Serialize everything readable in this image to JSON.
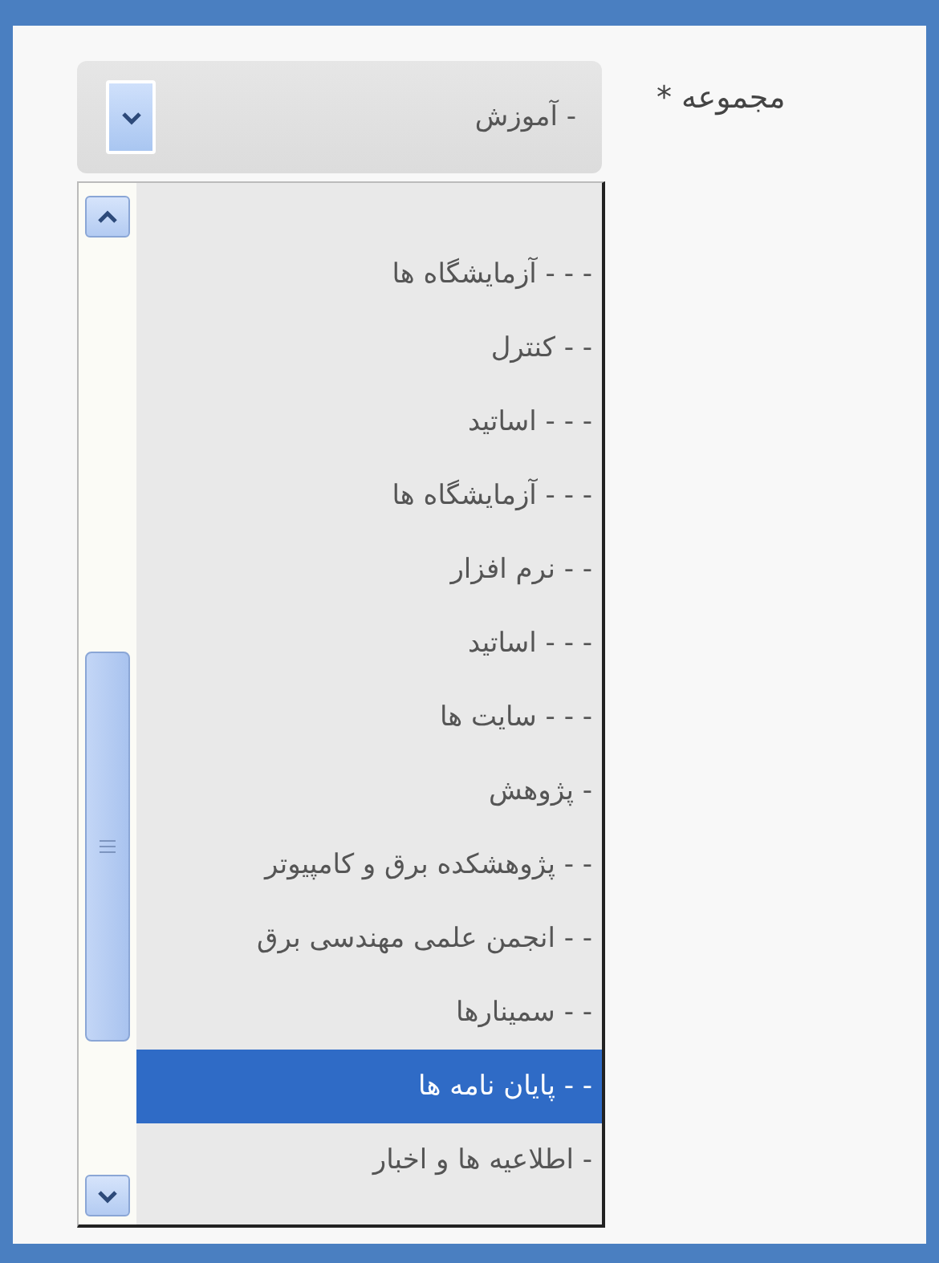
{
  "field": {
    "label": "مجموعه *",
    "value": "- آموزش"
  },
  "options": [
    {
      "label": "- - - آزمایشگاه ها",
      "selected": false
    },
    {
      "label": "- - کنترل",
      "selected": false
    },
    {
      "label": "- - - اساتید",
      "selected": false
    },
    {
      "label": "- - - آزمایشگاه ها",
      "selected": false
    },
    {
      "label": "- - نرم افزار",
      "selected": false
    },
    {
      "label": "- - - اساتید",
      "selected": false
    },
    {
      "label": "- - - سایت ها",
      "selected": false
    },
    {
      "label": "- پژوهش",
      "selected": false
    },
    {
      "label": "- - پژوهشکده برق و کامپیوتر",
      "selected": false
    },
    {
      "label": "- - انجمن علمی مهندسی برق",
      "selected": false
    },
    {
      "label": "- - سمینارها",
      "selected": false
    },
    {
      "label": "- - پایان نامه ها",
      "selected": true
    },
    {
      "label": "- اطلاعیه ها و اخبار",
      "selected": false
    }
  ]
}
